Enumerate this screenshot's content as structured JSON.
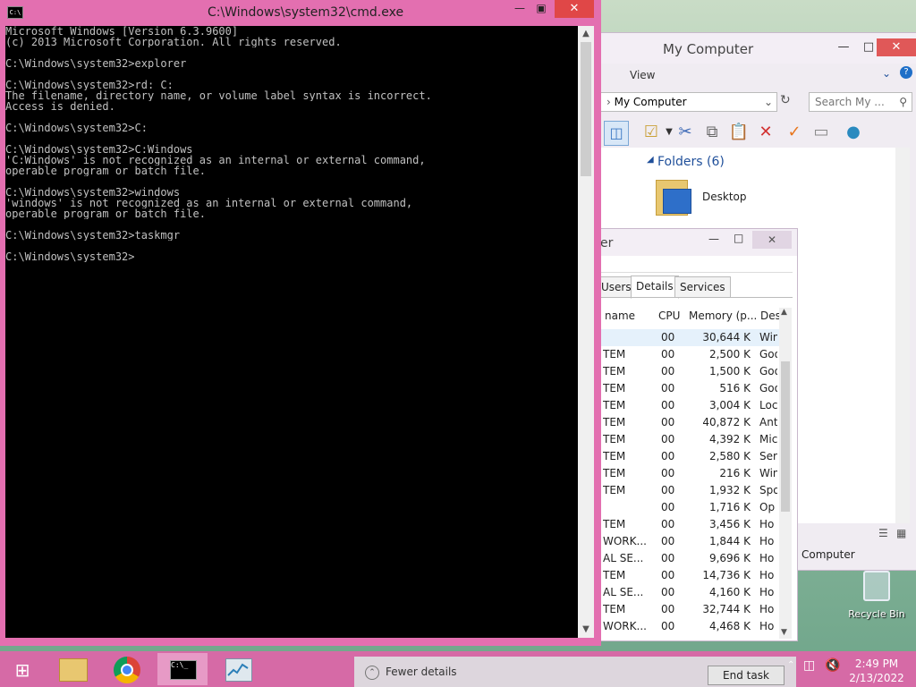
{
  "explorer": {
    "title": "My Computer",
    "ribbon_view": "View",
    "address": "My Computer",
    "search_placeholder": "Search My ...",
    "folders_header": "Folders (6)",
    "folder_desktop": "Desktop",
    "nav_computer": "Computer"
  },
  "taskmgr": {
    "title_partial": "er",
    "tabs": [
      "Users",
      "Details",
      "Services"
    ],
    "active_tab": "Details",
    "columns": {
      "name": "name",
      "cpu": "CPU",
      "memory": "Memory (p...",
      "desc": "Des"
    },
    "rows": [
      {
        "name": "",
        "cpu": "00",
        "mem": "30,644 K",
        "desc": "Win"
      },
      {
        "name": "TEM",
        "cpu": "00",
        "mem": "2,500 K",
        "desc": "Goo"
      },
      {
        "name": "TEM",
        "cpu": "00",
        "mem": "1,500 K",
        "desc": "Goo"
      },
      {
        "name": "TEM",
        "cpu": "00",
        "mem": "516 K",
        "desc": "Goo"
      },
      {
        "name": "TEM",
        "cpu": "00",
        "mem": "3,004 K",
        "desc": "Loc"
      },
      {
        "name": "TEM",
        "cpu": "00",
        "mem": "40,872 K",
        "desc": "Ant"
      },
      {
        "name": "TEM",
        "cpu": "00",
        "mem": "4,392 K",
        "desc": "Mic"
      },
      {
        "name": "TEM",
        "cpu": "00",
        "mem": "2,580 K",
        "desc": "Ser"
      },
      {
        "name": "TEM",
        "cpu": "00",
        "mem": "216 K",
        "desc": "Win"
      },
      {
        "name": "TEM",
        "cpu": "00",
        "mem": "1,932 K",
        "desc": "Spo"
      },
      {
        "name": "",
        "cpu": "00",
        "mem": "1,716 K",
        "desc": "Op"
      },
      {
        "name": "TEM",
        "cpu": "00",
        "mem": "3,456 K",
        "desc": "Ho"
      },
      {
        "name": "WORK...",
        "cpu": "00",
        "mem": "1,844 K",
        "desc": "Ho"
      },
      {
        "name": "AL SE...",
        "cpu": "00",
        "mem": "9,696 K",
        "desc": "Ho"
      },
      {
        "name": "TEM",
        "cpu": "00",
        "mem": "14,736 K",
        "desc": "Ho"
      },
      {
        "name": "AL SE...",
        "cpu": "00",
        "mem": "4,160 K",
        "desc": "Ho"
      },
      {
        "name": "TEM",
        "cpu": "00",
        "mem": "32,744 K",
        "desc": "Ho"
      },
      {
        "name": "WORK...",
        "cpu": "00",
        "mem": "4,468 K",
        "desc": "Ho"
      }
    ],
    "fewer_details": "Fewer details",
    "end_task": "End task"
  },
  "cmd": {
    "title": "C:\\Windows\\system32\\cmd.exe",
    "lines": [
      "Microsoft Windows [Version 6.3.9600]",
      "(c) 2013 Microsoft Corporation. All rights reserved.",
      "",
      "C:\\Windows\\system32>explorer",
      "",
      "C:\\Windows\\system32>rd: C:",
      "The filename, directory name, or volume label syntax is incorrect.",
      "Access is denied.",
      "",
      "C:\\Windows\\system32>C:",
      "",
      "C:\\Windows\\system32>C:Windows",
      "'C:Windows' is not recognized as an internal or external command,",
      "operable program or batch file.",
      "",
      "C:\\Windows\\system32>windows",
      "'windows' is not recognized as an internal or external command,",
      "operable program or batch file.",
      "",
      "C:\\Windows\\system32>taskmgr",
      "",
      "C:\\Windows\\system32>"
    ]
  },
  "desktop": {
    "recycle_bin": "Recycle Bin"
  },
  "taskbar": {
    "clock_time": "2:49 PM",
    "clock_date": "2/13/2022",
    "apps": [
      "start-icon",
      "file-explorer-icon",
      "chrome-icon",
      "cmd-icon",
      "task-manager-icon"
    ]
  },
  "colors": {
    "taskbar": "#d66aa6",
    "window_frame": "#e36fb0",
    "close": "#e04747"
  }
}
